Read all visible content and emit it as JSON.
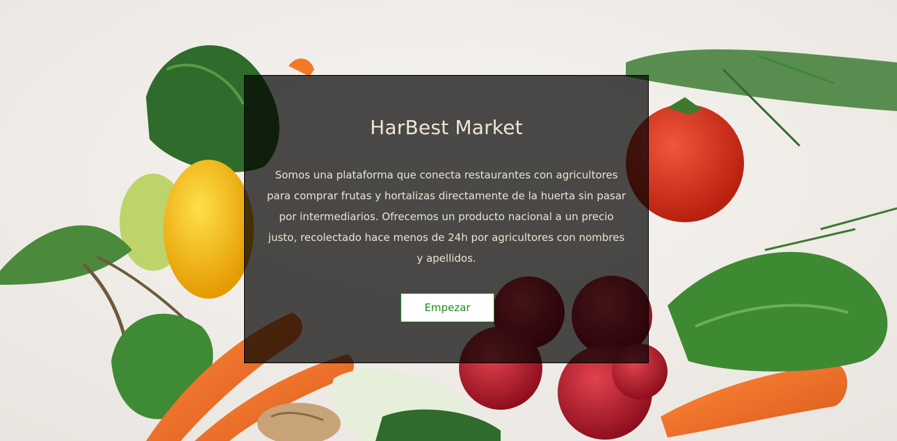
{
  "hero": {
    "title": "HarBest Market",
    "description": "Somos una plataforma que conecta restaurantes con agricultores para comprar frutas y hortalizas directamente de la huerta sin pasar por intermediarios. Ofrecemos un producto nacional a un precio justo, recolectado hace menos de 24h por agricultores con nombres y apellidos.",
    "cta_label": "Empezar"
  },
  "colors": {
    "panel_overlay": "#000000",
    "title_text": "#efe6d4",
    "cta_border": "#1f8a1f",
    "cta_text": "#1f8a1f"
  }
}
